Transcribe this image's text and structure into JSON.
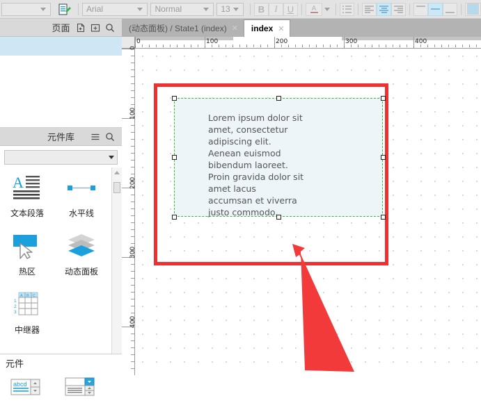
{
  "toolbar": {
    "style_combo_value": "",
    "format_painter_icon": "format-painter-icon",
    "font_family": "Arial",
    "font_style": "Normal",
    "font_size": "13",
    "bold_label": "B",
    "italic_label": "I",
    "underline_label": "U",
    "text_color_label": "A",
    "bullet_list_icon": "bullet-list-icon",
    "align_left_icon": "align-left-icon",
    "align_center_icon": "align-center-icon",
    "align_right_icon": "align-right-icon",
    "valign_top_icon": "valign-top-icon",
    "valign_middle_icon": "valign-middle-icon",
    "valign_bottom_icon": "valign-bottom-icon",
    "fill_color_icon": "fill-color-icon",
    "accent_color": "#cce8f7"
  },
  "pages_panel": {
    "title": "页面",
    "add_page_icon": "add-page-icon",
    "add_folder_icon": "add-folder-icon",
    "search_icon": "search-icon"
  },
  "library_panel": {
    "title": "元件库",
    "menu_icon": "hamburger-menu-icon",
    "search_icon": "search-icon",
    "selector_value": "",
    "widgets": [
      {
        "label": "文本段落",
        "icon": "text-paragraph-icon"
      },
      {
        "label": "水平线",
        "icon": "horizontal-line-icon"
      },
      {
        "label": "热区",
        "icon": "hot-spot-icon"
      },
      {
        "label": "动态面板",
        "icon": "dynamic-panel-icon"
      },
      {
        "label": "中继器",
        "icon": "repeater-icon"
      }
    ],
    "section_title": "元件",
    "section_widgets": [
      {
        "label": "",
        "icon": "text-field-spinner-icon"
      },
      {
        "label": "",
        "icon": "list-box-spinner-icon"
      }
    ],
    "scrollbar_up_icon": "scroll-up-arrow-icon"
  },
  "tabs": [
    {
      "label": "(动态面板) / State1 (index)",
      "active": false,
      "close_icon": "close-icon"
    },
    {
      "label": "index",
      "active": true,
      "close_icon": "close-icon"
    }
  ],
  "rulers": {
    "horizontal_ticks": [
      "0",
      "100",
      "200",
      "300",
      "400"
    ],
    "vertical_ticks": [
      "0",
      "100",
      "200",
      "300",
      "400"
    ],
    "unit_step": 100
  },
  "canvas": {
    "grid_dot_spacing": 20,
    "grid_dot_color": "#5555cc",
    "highlight_rect_color": "#f03030",
    "selection_border_color": "#2fc22f",
    "widget_fill_color": "#eef5f8",
    "paragraph_text": "Lorem ipsum dolor sit\namet, consectetur\nadipiscing elit.\nAenean euismod\nbibendum laoreet.\nProin gravida dolor sit\namet lacus\naccumsan et viverra\njusto commodo.",
    "annotation_arrow_color": "#f23a3a",
    "selection_handle_count": 8
  }
}
